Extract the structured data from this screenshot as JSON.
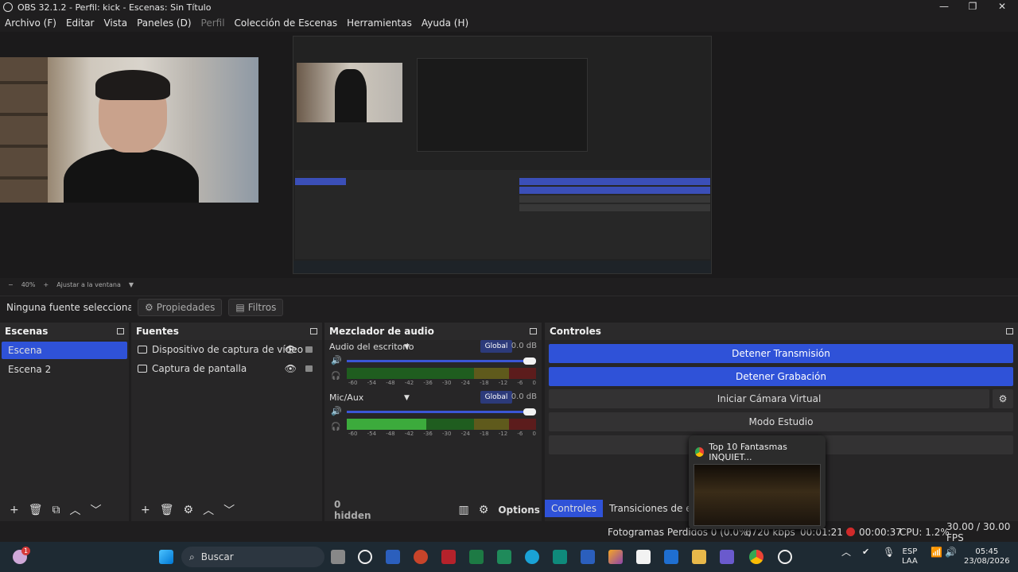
{
  "window": {
    "title": "OBS 32.1.2 - Perfil: kick - Escenas: Sin Título",
    "minimize": "—",
    "maximize": "❐",
    "close": "✕"
  },
  "menu": [
    "Archivo (F)",
    "Editar",
    "Vista",
    "Paneles (D)",
    "Perfil",
    "Colección de Escenas",
    "Herramientas",
    "Ayuda (H)"
  ],
  "zoom": {
    "minus": "−",
    "level": "40%",
    "plus": "+",
    "fit": "Ajustar a la ventana"
  },
  "prop_bar": {
    "source_label": "Ninguna fuente seleccionada",
    "properties": "Propiedades",
    "filters": "Filtros"
  },
  "scenes": {
    "title": "Escenas",
    "items": [
      "Escena",
      "Escena 2"
    ],
    "footer": [
      "+",
      "🗑",
      "⧉",
      "︿",
      "﹀"
    ]
  },
  "sources": {
    "title": "Fuentes",
    "items": [
      "Dispositivo de captura de vídeo",
      "Captura de pantalla"
    ],
    "footer": [
      "+",
      "🗑",
      "⚙",
      "︿",
      "﹀"
    ]
  },
  "mixer": {
    "title": "Mezclador de audio",
    "channels": [
      {
        "name": "Audio del escritorio",
        "mode": "Global",
        "db": "0.0 dB",
        "level": 1.0
      },
      {
        "name": "Mic/Aux",
        "mode": "Global",
        "db": "0.0 dB",
        "level": 1.0
      }
    ],
    "scale": [
      "-60",
      "-54",
      "-48",
      "-42",
      "-36",
      "-30",
      "-24",
      "-18",
      "-12",
      "-6",
      "0"
    ],
    "hidden": "0 hidden",
    "options": "Options"
  },
  "controls": {
    "title": "Controles",
    "buttons": [
      "Detener Transmisión",
      "Detener Grabación",
      "Iniciar Cámara Virtual",
      "Modo Estudio"
    ],
    "tabs": [
      "Controles",
      "Transiciones de escena"
    ]
  },
  "status": {
    "frames_dropped": "Fotogramas Perdidos 0 (0.0%)",
    "kbps": "6720 kbps",
    "stream_time": "00:01:21",
    "rec_time": "00:00:37",
    "cpu": "CPU: 1.2%",
    "fps": "30.00 / 30.00 FPS"
  },
  "popup": {
    "title": "Top 10 Fantasmas INQUIET..."
  },
  "taskbar": {
    "search": "Buscar",
    "lang": "ESP",
    "lang2": "LAA",
    "time": "05:45",
    "date": "23/08/2026",
    "notify_count": "1"
  },
  "colors": {
    "accent": "#2f52d8",
    "panel": "#272627",
    "bg": "#1f1e1f"
  }
}
